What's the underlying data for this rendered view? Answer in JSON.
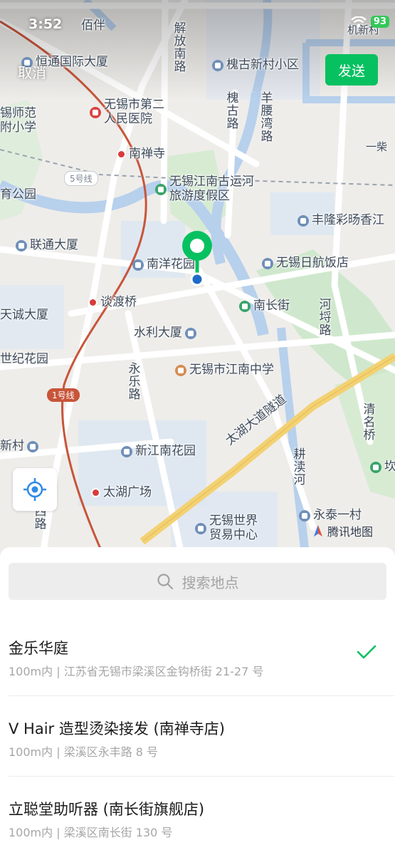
{
  "status_bar": {
    "time": "3:52",
    "battery": "93"
  },
  "header": {
    "cancel": "取消",
    "send": "发送"
  },
  "map": {
    "labels": {
      "peiban": "佰伴",
      "hengtong": "恒通国际大厦",
      "jiefang_south": "解放南路",
      "huaigu_village": "槐古新村小区",
      "huaigu_road": "槐古路",
      "yangyao_bay": "羊腰湾路",
      "no2_hospital": "无锡市第二人民医院",
      "teacher_school": "锡师范\n附小学",
      "nanchan_temple": "南禅寺",
      "line5": "5号线",
      "canal_resort": "无锡江南古运河\n旅游度假区",
      "yu_park": "育公园",
      "fenglong": "丰隆彩旸香江",
      "liantong": "联通大厦",
      "nanyang": "南洋花园",
      "rihang": "无锡日航饭店",
      "tandu": "谈渡桥",
      "nanchang_street": "南长街",
      "tiancheng": "天诚大厦",
      "shuili": "水利大厦",
      "shiji": "世纪花园",
      "jiangnan_school": "无锡市江南中学",
      "yongle_road": "永乐路",
      "line1": "1号线",
      "xin_village": "新村",
      "xinjiangnan": "新江南花园",
      "taihu_tunnel": "太湖大道隧道",
      "gengdu_river": "耕渎河",
      "taihu_square": "太湖广场",
      "wtc": "无锡世界\n贸易中心",
      "yongtai": "永泰一村",
      "tencent_map": "腾讯地图",
      "qingming": "清名桥",
      "hebei": "河埒路",
      "kan": "坎",
      "xi_road": "西路",
      "chai": "一柴",
      "jinan": "机新村"
    }
  },
  "locate_button": {
    "icon": "locate-icon"
  },
  "search": {
    "placeholder": "搜索地点",
    "icon": "search-icon"
  },
  "results": [
    {
      "name": "金乐华庭",
      "address": "100m内 | 江苏省无锡市梁溪区金钩桥街 21-27 号",
      "selected": true
    },
    {
      "name": "V Hair 造型烫染接发 (南禅寺店)",
      "address": "100m内 | 梁溪区永丰路 8 号",
      "selected": false
    },
    {
      "name": "立聪堂助听器 (南长街旗舰店)",
      "address": "100m内 | 梁溪区南长街 130 号",
      "selected": false
    }
  ],
  "colors": {
    "accent": "#07c160",
    "pin": "#07c160",
    "water": "#cfe0f3",
    "metro_line": "#c8553a"
  }
}
